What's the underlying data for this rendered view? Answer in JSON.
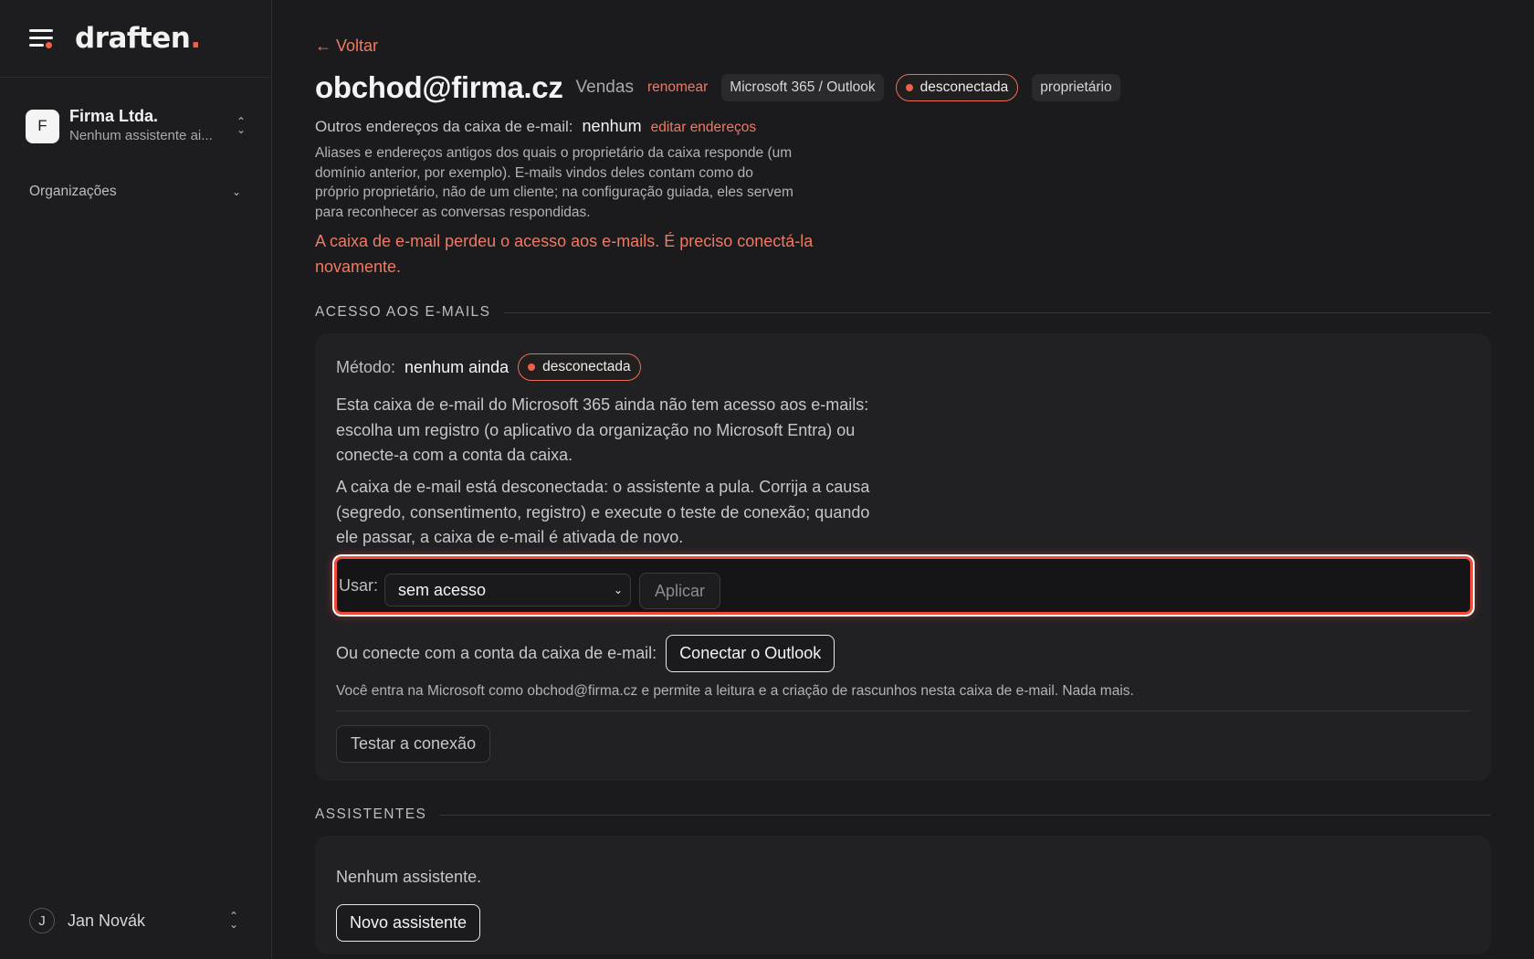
{
  "app": {
    "logo_text": "draften",
    "logo_dot": ".",
    "accent": "#ef5f4a"
  },
  "sidebar": {
    "org": {
      "initial": "F",
      "name": "Firma Ltda.",
      "subtitle": "Nenhum assistente ai..."
    },
    "organizations_label": "Organizações",
    "user": {
      "initial": "J",
      "name": "Jan Novák"
    },
    "icons": {
      "menu": "menu-icon",
      "org_switch": "updown-icon",
      "organizations": "chevron-down-icon",
      "user_switch": "updown-icon"
    }
  },
  "header": {
    "back": "← Voltar",
    "title": "obchod@firma.cz",
    "team": "Vendas",
    "rename": "renomear",
    "provider": "Microsoft 365 / Outlook",
    "status": "desconectada",
    "role": "proprietário"
  },
  "aliases": {
    "label": "Outros endereços da caixa de e-mail:",
    "value": "nenhum",
    "edit": "editar endereços",
    "description": "Aliases e endereços antigos dos quais o proprietário da caixa responde (um domínio anterior, por exemplo). E-mails vindos deles contam como do próprio proprietário, não de um cliente; na configuração guiada, eles servem para reconhecer as conversas respondidas."
  },
  "warning": "A caixa de e-mail perdeu o acesso aos e-mails. É preciso conectá-la novamente.",
  "access": {
    "section_title": "ACESSO AOS E-MAILS",
    "method_label": "Método:",
    "method_value": "nenhum ainda",
    "status": "desconectada",
    "paragraph1": "Esta caixa de e-mail do Microsoft 365 ainda não tem acesso aos e-mails: escolha um registro (o aplicativo da organização no Microsoft Entra) ou conecte-a com a conta da caixa.",
    "paragraph2": "A caixa de e-mail está desconectada: o assistente a pula. Corrija a causa (segredo, consentimento, registro) e execute o teste de conexão; quando ele passar, a caixa de e-mail é ativada de novo.",
    "use_label": "Usar:",
    "use_selected": "sem acesso",
    "apply": "Aplicar",
    "connect_label": "Ou conecte com a conta da caixa de e-mail:",
    "connect_button": "Conectar o Outlook",
    "connect_note": "Você entra na Microsoft como obchod@firma.cz e permite a leitura e a criação de rascunhos nesta caixa de e-mail. Nada mais.",
    "test_button": "Testar a conexão"
  },
  "assistants": {
    "section_title": "ASSISTENTES",
    "empty": "Nenhum assistente.",
    "new_button": "Novo assistente"
  }
}
